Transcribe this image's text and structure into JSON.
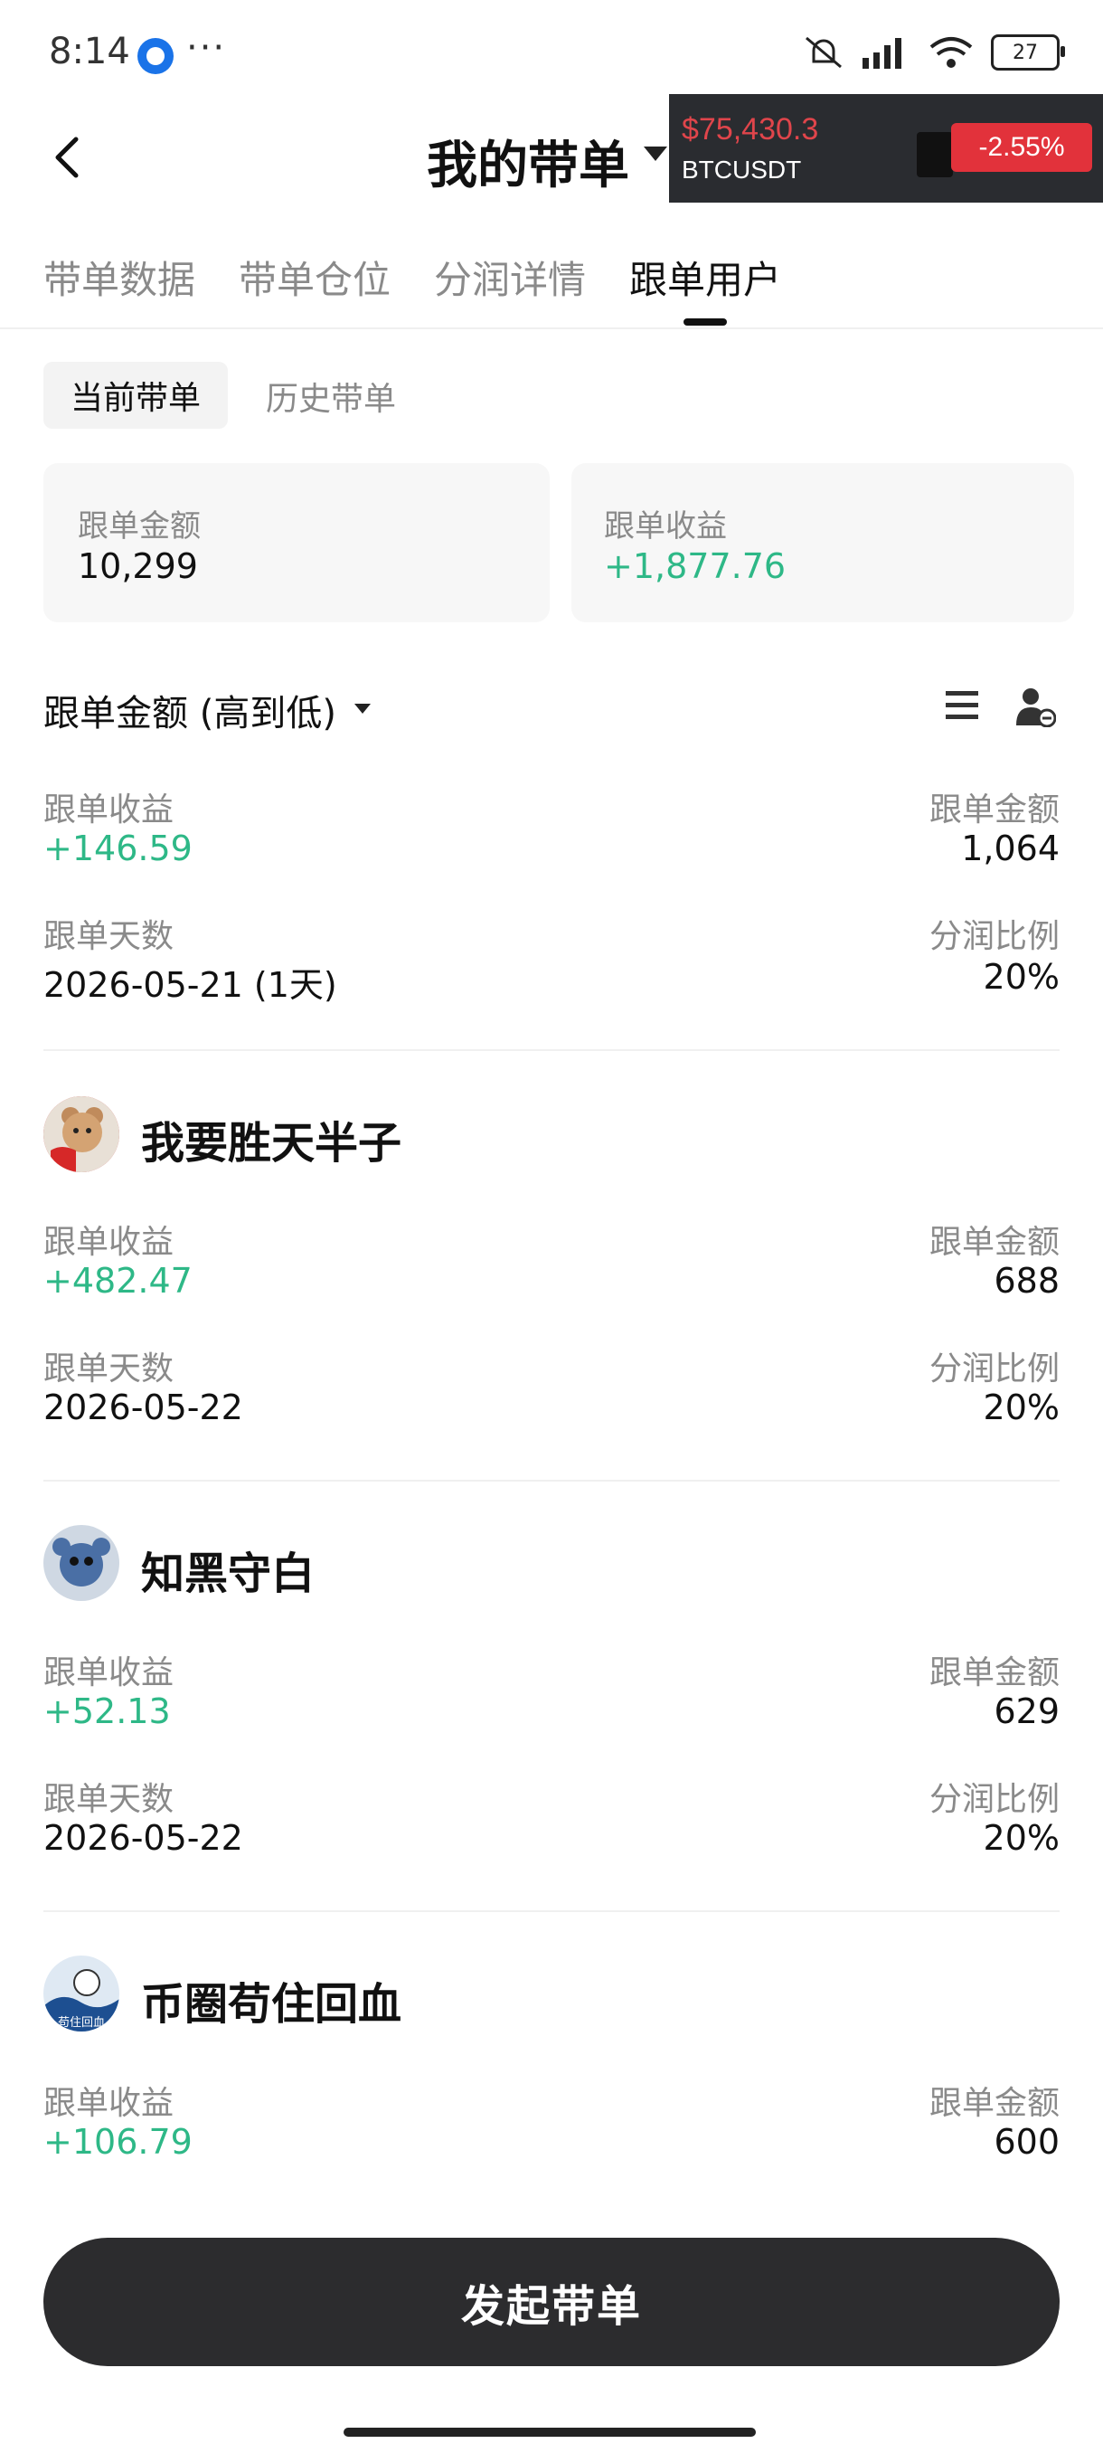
{
  "status_bar": {
    "time": "8:14",
    "dots": "···",
    "battery": "27"
  },
  "header": {
    "title": "我的带单"
  },
  "ticker": {
    "price": "$75,430.3",
    "symbol": "BTCUSDT",
    "change": "-2.55%"
  },
  "tabs": [
    {
      "label": "带单数据",
      "active": false
    },
    {
      "label": "带单仓位",
      "active": false
    },
    {
      "label": "分润详情",
      "active": false
    },
    {
      "label": "跟单用户",
      "active": true
    }
  ],
  "segments": {
    "current": "当前带单",
    "history": "历史带单"
  },
  "summary": {
    "amount_label": "跟单金额",
    "amount_value": "10,299",
    "profit_label": "跟单收益",
    "profit_value": "+1,877.76"
  },
  "sort": {
    "label": "跟单金额 (高到低)"
  },
  "followers": [
    {
      "name": "",
      "profit_label": "跟单收益",
      "profit": "+146.59",
      "amount_label": "跟单金额",
      "amount": "1,064",
      "days_label": "跟单天数",
      "days": "2026-05-21 (1天)",
      "ratio_label": "分润比例",
      "ratio": "20%"
    },
    {
      "name": "我要胜天半子",
      "profit_label": "跟单收益",
      "profit": "+482.47",
      "amount_label": "跟单金额",
      "amount": "688",
      "days_label": "跟单天数",
      "days": "2026-05-22",
      "ratio_label": "分润比例",
      "ratio": "20%"
    },
    {
      "name": "知黑守白",
      "profit_label": "跟单收益",
      "profit": "+52.13",
      "amount_label": "跟单金额",
      "amount": "629",
      "days_label": "跟单天数",
      "days": "2026-05-22",
      "ratio_label": "分润比例",
      "ratio": "20%"
    },
    {
      "name": "币圈苟住回血",
      "avatar_text": "苟住回血",
      "profit_label": "跟单收益",
      "profit": "+106.79",
      "amount_label": "跟单金额",
      "amount": "600"
    }
  ],
  "cta": {
    "label": "发起带单"
  },
  "colors": {
    "green": "#2eb887",
    "red": "#e2323b",
    "dark": "#2c2c2e"
  }
}
